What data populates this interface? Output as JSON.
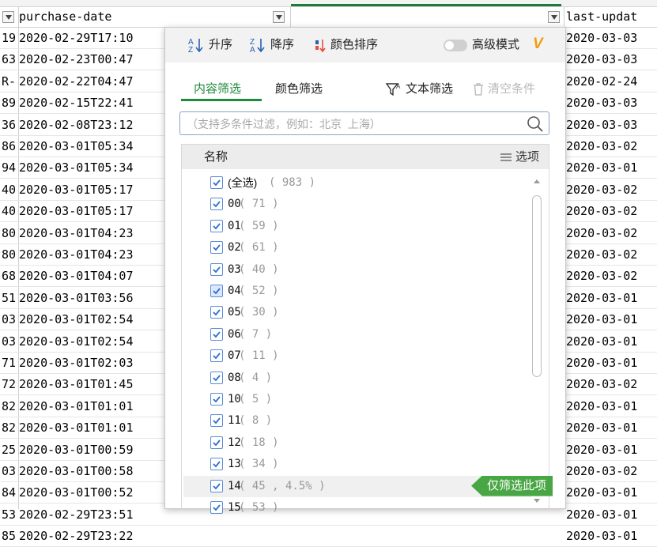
{
  "sheet": {
    "headers": {
      "col_b": "purchase-date",
      "col_d": "last-updat"
    },
    "rows": [
      {
        "a": "19",
        "b": "2020-02-29T17:10",
        "c": "2020-03-03"
      },
      {
        "a": "63",
        "b": "2020-02-23T00:47",
        "c": "2020-03-03"
      },
      {
        "a": "R-",
        "b": "2020-02-22T04:47",
        "c": "2020-02-24"
      },
      {
        "a": "89",
        "b": "2020-02-15T22:41",
        "c": "2020-03-03"
      },
      {
        "a": "36",
        "b": "2020-02-08T23:12",
        "c": "2020-03-03"
      },
      {
        "a": "86",
        "b": "2020-03-01T05:34",
        "c": "2020-03-02"
      },
      {
        "a": "94",
        "b": "2020-03-01T05:34",
        "c": "2020-03-01"
      },
      {
        "a": "40",
        "b": "2020-03-01T05:17",
        "c": "2020-03-02"
      },
      {
        "a": "40",
        "b": "2020-03-01T05:17",
        "c": "2020-03-02"
      },
      {
        "a": "80",
        "b": "2020-03-01T04:23",
        "c": "2020-03-02"
      },
      {
        "a": "80",
        "b": "2020-03-01T04:23",
        "c": "2020-03-02"
      },
      {
        "a": "68",
        "b": "2020-03-01T04:07",
        "c": "2020-03-02"
      },
      {
        "a": "51",
        "b": "2020-03-01T03:56",
        "c": "2020-03-01"
      },
      {
        "a": "03",
        "b": "2020-03-01T02:54",
        "c": "2020-03-01"
      },
      {
        "a": "03",
        "b": "2020-03-01T02:54",
        "c": "2020-03-01"
      },
      {
        "a": "71",
        "b": "2020-03-01T02:03",
        "c": "2020-03-01"
      },
      {
        "a": "72",
        "b": "2020-03-01T01:45",
        "c": "2020-03-02"
      },
      {
        "a": "82",
        "b": "2020-03-01T01:01",
        "c": "2020-03-01"
      },
      {
        "a": "82",
        "b": "2020-03-01T01:01",
        "c": "2020-03-01"
      },
      {
        "a": "25",
        "b": "2020-03-01T00:59",
        "c": "2020-03-01"
      },
      {
        "a": "03",
        "b": "2020-03-01T00:58",
        "c": "2020-03-02"
      },
      {
        "a": "84",
        "b": "2020-03-01T00:52",
        "c": "2020-03-01"
      },
      {
        "a": "53",
        "b": "2020-02-29T23:51",
        "c": "2020-03-01"
      },
      {
        "a": "85",
        "b": "2020-02-29T23:22",
        "c": "2020-03-01"
      }
    ]
  },
  "filter": {
    "sort_asc": "升序",
    "sort_desc": "降序",
    "sort_color": "颜色排序",
    "advanced_mode": "高级模式",
    "vip_badge": "V",
    "tab_content": "内容筛选",
    "tab_color": "颜色筛选",
    "text_filter": "文本筛选",
    "clear_conditions": "清空条件",
    "search_placeholder": "（支持多条件过滤，例如：北京  上海）",
    "list_header_name": "名称",
    "list_header_options": "选项",
    "only_this": "仅筛选此项",
    "items": [
      {
        "label": "(全选)",
        "count": "( 983 )"
      },
      {
        "label": "00",
        "count": "( 71 )"
      },
      {
        "label": "01",
        "count": "( 59 )"
      },
      {
        "label": "02",
        "count": "( 61 )"
      },
      {
        "label": "03",
        "count": "( 40 )"
      },
      {
        "label": "04",
        "count": "( 52 )"
      },
      {
        "label": "05",
        "count": "( 30 )"
      },
      {
        "label": "06",
        "count": "( 7 )"
      },
      {
        "label": "07",
        "count": "( 11 )"
      },
      {
        "label": "08",
        "count": "( 4 )"
      },
      {
        "label": "10",
        "count": "( 5 )"
      },
      {
        "label": "11",
        "count": "( 8 )"
      },
      {
        "label": "12",
        "count": "( 18 )"
      },
      {
        "label": "13",
        "count": "( 34 )"
      },
      {
        "label": "14",
        "count": "( 45 , 4.5% )"
      },
      {
        "label": "15",
        "count": "( 53 )"
      }
    ]
  }
}
